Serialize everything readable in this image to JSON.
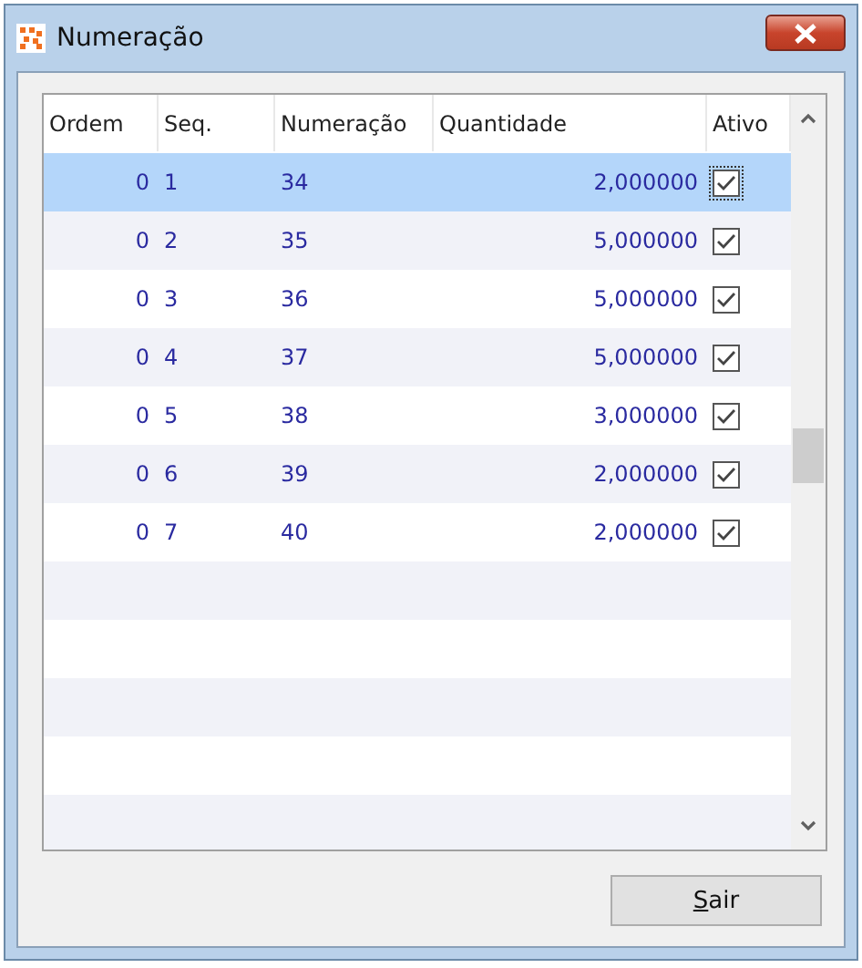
{
  "window": {
    "title": "Numeração"
  },
  "table": {
    "columns": [
      "Ordem",
      "Seq.",
      "Numeração",
      "Quantidade",
      "Ativo"
    ],
    "rows": [
      {
        "ordem": "0",
        "seq": "1",
        "numeracao": "34",
        "quantidade": "2,000000",
        "ativo": true,
        "selected": true
      },
      {
        "ordem": "0",
        "seq": "2",
        "numeracao": "35",
        "quantidade": "5,000000",
        "ativo": true,
        "selected": false
      },
      {
        "ordem": "0",
        "seq": "3",
        "numeracao": "36",
        "quantidade": "5,000000",
        "ativo": true,
        "selected": false
      },
      {
        "ordem": "0",
        "seq": "4",
        "numeracao": "37",
        "quantidade": "5,000000",
        "ativo": true,
        "selected": false
      },
      {
        "ordem": "0",
        "seq": "5",
        "numeracao": "38",
        "quantidade": "3,000000",
        "ativo": true,
        "selected": false
      },
      {
        "ordem": "0",
        "seq": "6",
        "numeracao": "39",
        "quantidade": "2,000000",
        "ativo": true,
        "selected": false
      },
      {
        "ordem": "0",
        "seq": "7",
        "numeracao": "40",
        "quantidade": "2,000000",
        "ativo": true,
        "selected": false
      }
    ]
  },
  "buttons": [
    "Sair"
  ]
}
